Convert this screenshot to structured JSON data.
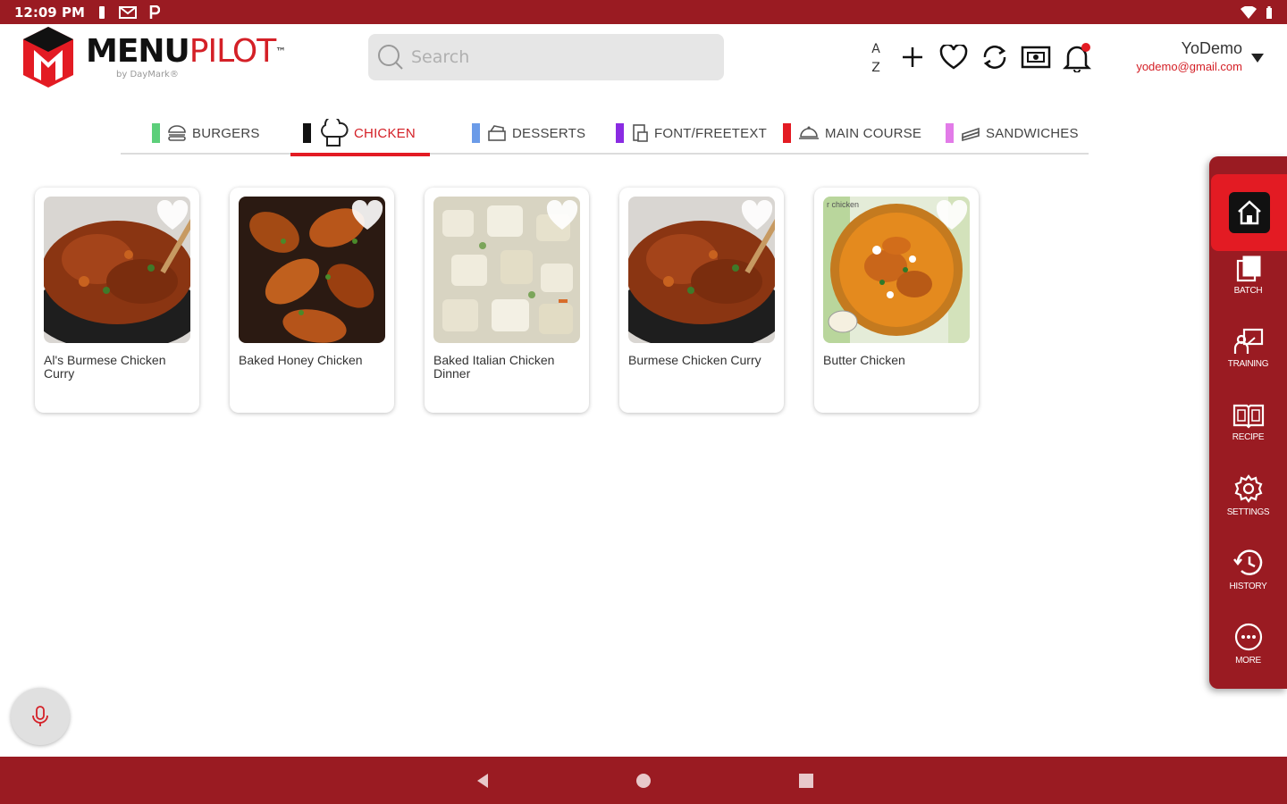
{
  "status_bar": {
    "time": "12:09 PM"
  },
  "app": {
    "logo_text_bold": "MENU",
    "logo_text_light": "PILOT",
    "logo_trademark": "™",
    "logo_byline": "by DayMark®"
  },
  "search": {
    "placeholder": "Search"
  },
  "toolbar": {
    "sort_icon": "sort-az-icon",
    "sort_top": "A",
    "sort_bottom": "Z",
    "icons": [
      "plus-icon",
      "heart-icon",
      "sync-icon",
      "display-icon",
      "bell-icon"
    ]
  },
  "user": {
    "name": "YoDemo",
    "email": "yodemo@gmail.com"
  },
  "tabs": [
    {
      "label": "BURGERS",
      "color": "#5ccf7a",
      "icon": "burger-icon"
    },
    {
      "label": "CHICKEN",
      "color": "#111111",
      "icon": "chef-hat-icon",
      "active": true
    },
    {
      "label": "DESSERTS",
      "color": "#6b9be8",
      "icon": "dessert-icon"
    },
    {
      "label": "FONT/FREETEXT",
      "color": "#8a2be2",
      "icon": "document-icon"
    },
    {
      "label": "MAIN COURSE",
      "color": "#e31b23",
      "icon": "platter-icon"
    },
    {
      "label": "SANDWICHES",
      "color": "#e27be8",
      "icon": "sandwich-icon"
    }
  ],
  "cards": [
    {
      "title": "Al's Burmese Chicken Curry",
      "image": "curry-wok"
    },
    {
      "title": "Baked Honey Chicken",
      "image": "drumsticks"
    },
    {
      "title": "Baked Italian Chicken Dinner",
      "image": "potatoes"
    },
    {
      "title": "Burmese Chicken Curry",
      "image": "curry-wok"
    },
    {
      "title": "Butter Chicken",
      "image": "butter-chicken",
      "watermark": "r chicken"
    }
  ],
  "sidebar": {
    "home_icon": "home-icon",
    "items": [
      {
        "label": "BATCH",
        "icon": "batch-icon"
      },
      {
        "label": "TRAINING",
        "icon": "training-icon"
      },
      {
        "label": "RECIPE",
        "icon": "recipe-book-icon"
      },
      {
        "label": "SETTINGS",
        "icon": "gear-icon"
      },
      {
        "label": "HISTORY",
        "icon": "history-icon"
      },
      {
        "label": "MORE",
        "icon": "more-icon"
      }
    ]
  },
  "colors": {
    "brand_dark": "#9a1b22",
    "brand_red": "#e31b23"
  }
}
